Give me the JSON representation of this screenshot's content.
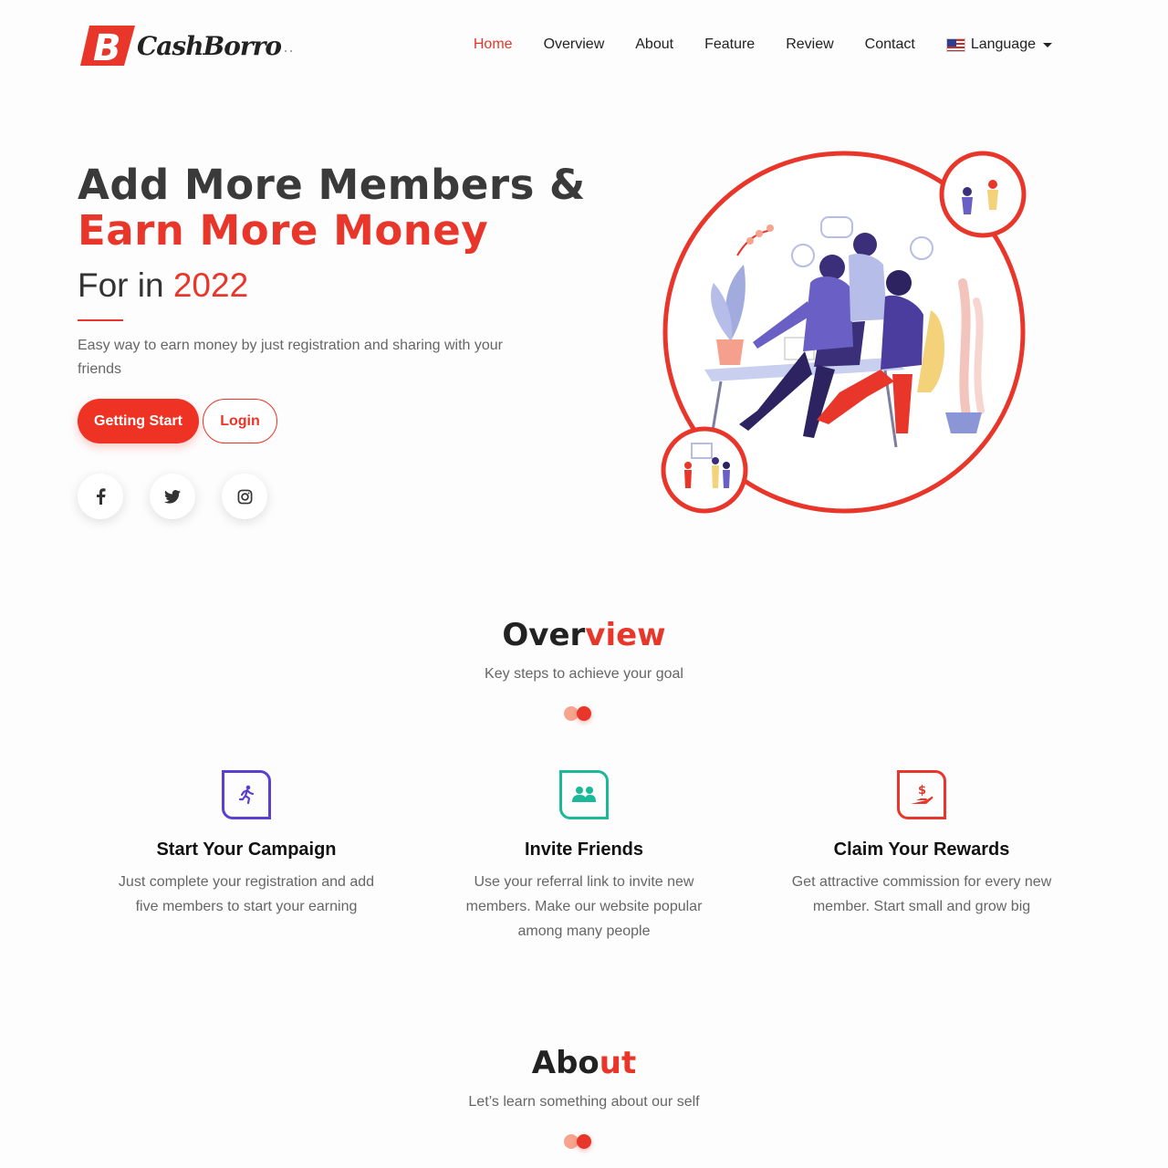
{
  "brand": {
    "name": "CashBorro",
    "mark_letter": "B",
    "accent": "#e8362a"
  },
  "nav": {
    "items": [
      "Home",
      "Overview",
      "About",
      "Feature",
      "Review",
      "Contact"
    ],
    "active": "Home",
    "language_label": "Language"
  },
  "hero": {
    "title_line1": "Add More Members &",
    "title_line2": "Earn More Money",
    "sub_prefix": "For in ",
    "sub_year": "2022",
    "description": "Easy way to earn money by just registration and sharing with your friends",
    "primary_button": "Getting Start",
    "secondary_button": "Login",
    "social": [
      {
        "icon": "facebook-icon",
        "glyph": "f"
      },
      {
        "icon": "twitter-icon",
        "glyph": "twitter"
      },
      {
        "icon": "instagram-icon",
        "glyph": "instagram"
      }
    ]
  },
  "overview": {
    "title_plain": "Over",
    "title_highlight": "view",
    "subtitle": "Key steps to achieve your goal",
    "features": [
      {
        "icon": "running-person-icon",
        "color": "#5b3fd0",
        "title": "Start Your Campaign",
        "description": "Just complete your registration and add five members to start your earning"
      },
      {
        "icon": "users-icon",
        "color": "#1bb89a",
        "title": "Invite Friends",
        "description": "Use your referral link to invite new members. Make our website popular among many people"
      },
      {
        "icon": "hand-dollar-icon",
        "color": "#e8362a",
        "title": "Claim Your Rewards",
        "description": "Get attractive commission for every new member. Start small and grow big"
      }
    ]
  },
  "about": {
    "title_plain": "Abo",
    "title_highlight": "ut",
    "subtitle": "Let’s learn something about our self"
  }
}
